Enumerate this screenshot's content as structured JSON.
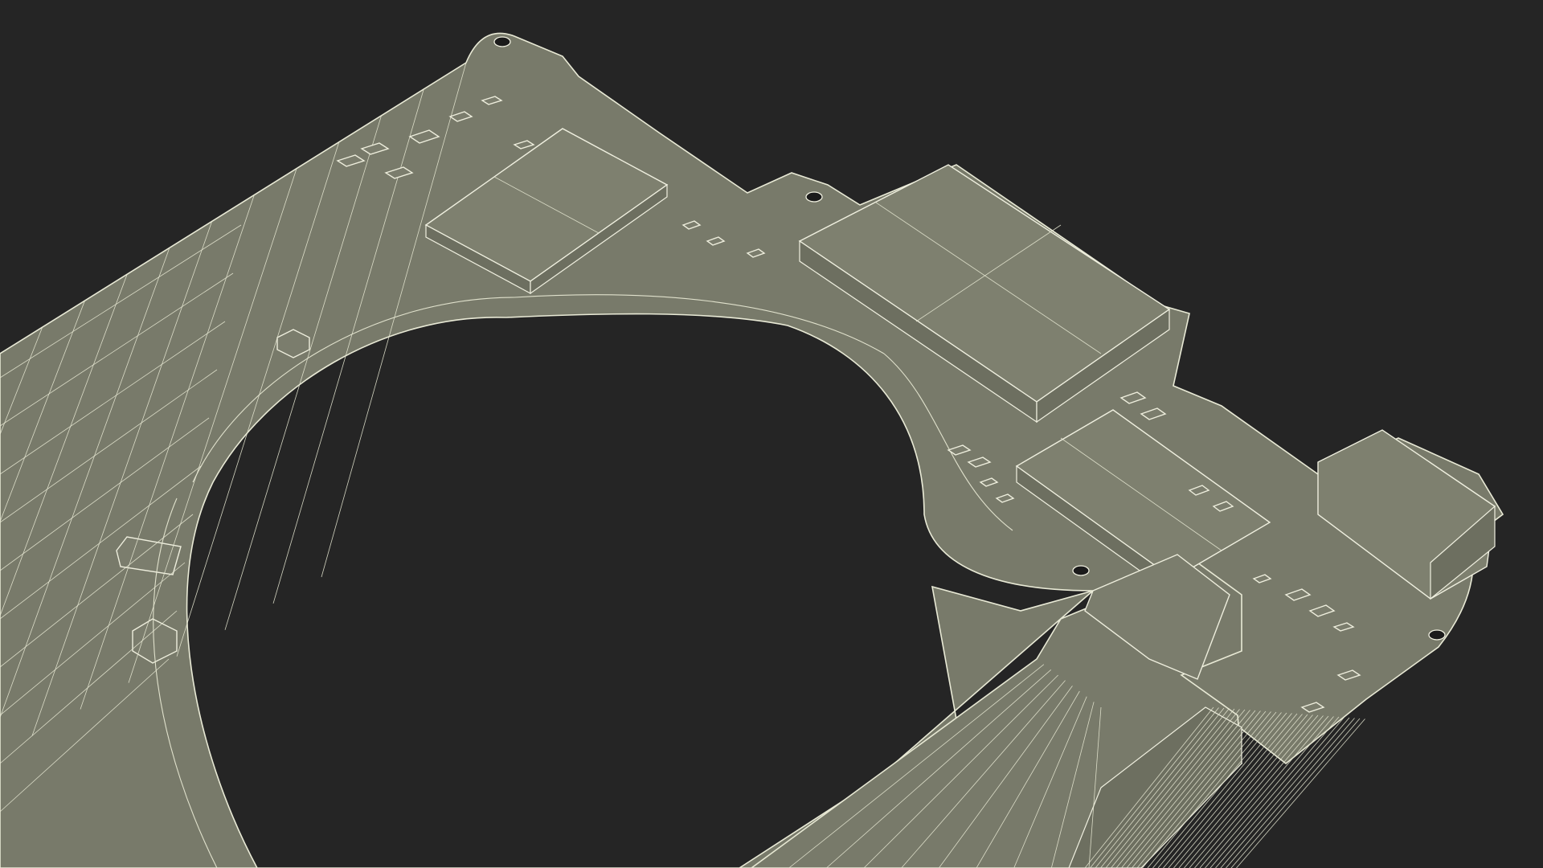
{
  "scene": {
    "subject": "pcb-board-wireframe-3d-render",
    "colors": {
      "background": "#252525",
      "board_fill": "#787a6a",
      "wireframe": "#e9ead6",
      "hole": "#1b1b1b"
    }
  }
}
